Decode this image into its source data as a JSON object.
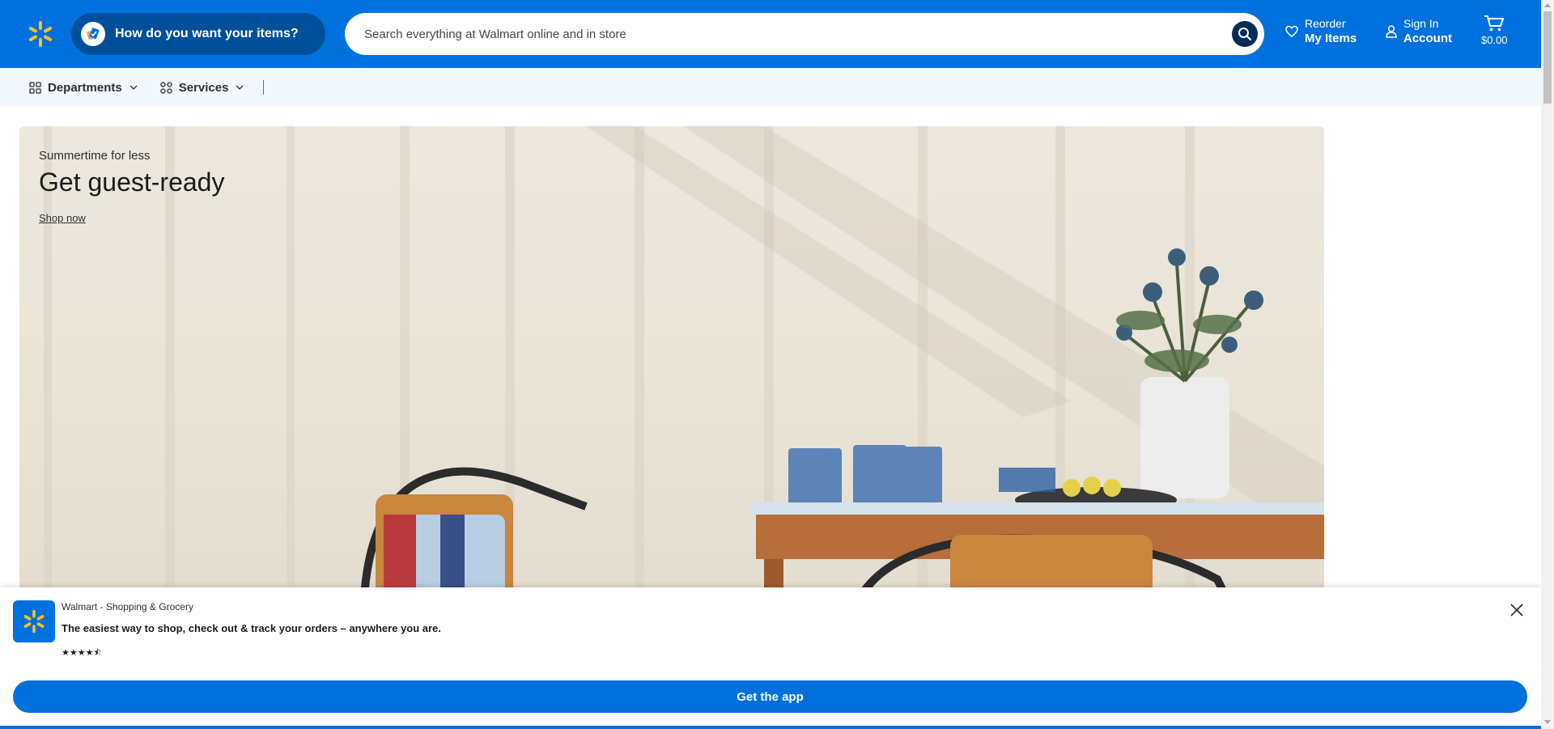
{
  "header": {
    "fulfillment_label": "How do you want your items?",
    "search_placeholder": "Search everything at Walmart online and in store",
    "reorder_small": "Reorder",
    "reorder_big": "My Items",
    "signin_small": "Sign In",
    "signin_big": "Account",
    "cart_amount": "$0.00",
    "brand_color": "#0071dc",
    "spark_color": "#ffc220"
  },
  "subnav": {
    "departments_label": "Departments",
    "services_label": "Services"
  },
  "hero": {
    "kicker": "Summertime for less",
    "title": "Get guest-ready",
    "link": "Shop now"
  },
  "app_banner": {
    "app_name": "Walmart - Shopping & Grocery",
    "tagline": "The easiest way to shop, check out & track your orders – anywhere you are.",
    "rating_stars": 4.5,
    "button_label": "Get the app"
  }
}
